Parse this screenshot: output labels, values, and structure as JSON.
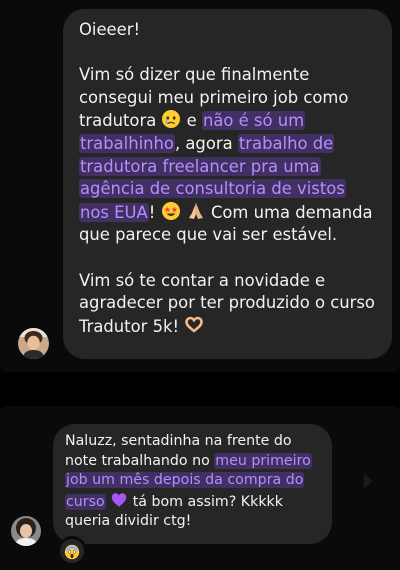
{
  "messages": [
    {
      "paragraphs": [
        {
          "segments": [
            {
              "text": "Oieeer!"
            }
          ]
        },
        {
          "segments": [
            {
              "text": "Vim só dizer que finalmente consegui meu primeiro job como tradutora "
            },
            {
              "emoji": "face-holding-back-tears-icon"
            },
            {
              "text": " e "
            },
            {
              "text": "não é só um trabalhinho",
              "highlight": true
            },
            {
              "text": ", agora "
            },
            {
              "text": "trabalho de tradutora freelancer pra uma agência de consultoria de vistos nos EUA",
              "highlight": true
            },
            {
              "text": "! "
            },
            {
              "emoji": "star-struck-face-icon"
            },
            {
              "emoji": "folded-hands-icon"
            },
            {
              "text": " Com uma demanda que parece que vai ser estável."
            }
          ]
        },
        {
          "segments": [
            {
              "text": "Vim só te contar a novidade e agradecer por ter produzido o curso Tradutor 5k! "
            },
            {
              "emoji": "heart-hands-icon"
            }
          ]
        }
      ]
    },
    {
      "paragraphs": [
        {
          "segments": [
            {
              "text": "Naluzz, sentadinha na frente do note trabalhando no "
            },
            {
              "text": "meu primeiro job um mês depois da compra do curso",
              "highlight": true
            },
            {
              "text": " "
            },
            {
              "emoji": "purple-heart-icon"
            },
            {
              "text": " tá bom assim? Kkkkk queria dividir ctg!"
            }
          ]
        }
      ],
      "reaction": "face-screaming-in-fear-icon"
    }
  ],
  "colors": {
    "background": "#000000",
    "card": "#0a0a0a",
    "bubble": "#262626",
    "text": "#f2f2f2",
    "highlight_text": "#b78cff",
    "highlight_bg": "#8a50ff"
  }
}
